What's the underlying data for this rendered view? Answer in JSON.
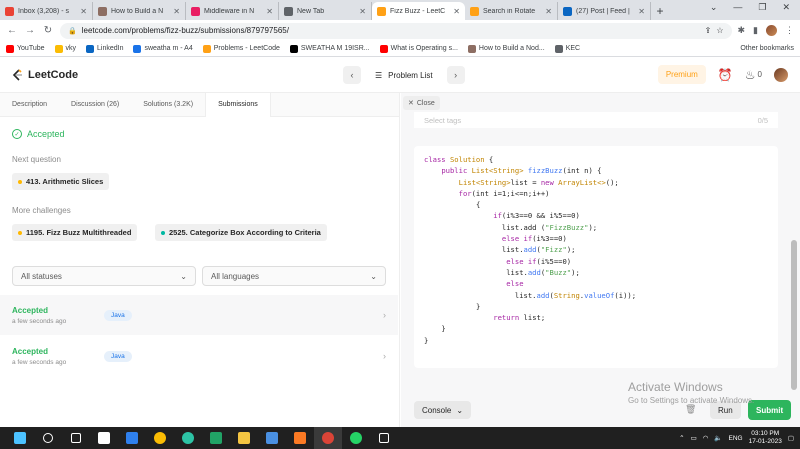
{
  "browser": {
    "tabs": [
      {
        "title": "Inbox (3,208) - s",
        "color": "#ea4335",
        "active": false
      },
      {
        "title": "How to Build a N",
        "color": "#8d6e63",
        "active": false
      },
      {
        "title": "Middleware in N",
        "color": "#e91e63",
        "active": false
      },
      {
        "title": "New Tab",
        "color": "#5f6368",
        "active": false
      },
      {
        "title": "Fizz Buzz - LeetC",
        "color": "#ffa116",
        "active": true
      },
      {
        "title": "Search in Rotate",
        "color": "#ffa116",
        "active": false
      },
      {
        "title": "(27) Post | Feed |",
        "color": "#0a66c2",
        "active": false
      }
    ],
    "new_tab": "+",
    "url": "leetcode.com/problems/fizz-buzz/submissions/879797565/",
    "bookmarks": [
      {
        "label": "YouTube",
        "color": "#ff0000"
      },
      {
        "label": "vky",
        "color": "#fbbc04"
      },
      {
        "label": "LinkedIn",
        "color": "#0a66c2"
      },
      {
        "label": "sweatha m - A4",
        "color": "#1a73e8"
      },
      {
        "label": "Problems - LeetCode",
        "color": "#ffa116"
      },
      {
        "label": "SWEATHA M 19ISR...",
        "color": "#000000"
      },
      {
        "label": "What is Operating s...",
        "color": "#ff0000"
      },
      {
        "label": "How to Build a Nod...",
        "color": "#8d6e63"
      },
      {
        "label": "KEC",
        "color": "#5f6368"
      }
    ],
    "other_bookmarks": "Other bookmarks"
  },
  "nav": {
    "logo": "LeetCode",
    "problem_list": "Problem List",
    "premium": "Premium",
    "streak_count": "0"
  },
  "left": {
    "tabs": [
      "Description",
      "Discussion (26)",
      "Solutions (3.2K)",
      "Submissions"
    ],
    "active_tab": 3,
    "status": "Accepted",
    "next_question_label": "Next question",
    "next_question": {
      "label": "413. Arithmetic Slices",
      "dot_color": "#ffb800"
    },
    "more_challenges_label": "More challenges",
    "challenges": [
      {
        "label": "1195. Fizz Buzz Multithreaded",
        "dot_color": "#ffb800"
      },
      {
        "label": "2525. Categorize Box According to Criteria",
        "dot_color": "#00b8a3"
      }
    ],
    "filters": {
      "statuses": "All statuses",
      "languages": "All languages"
    },
    "submissions": [
      {
        "status": "Accepted",
        "time": "a few seconds ago",
        "lang": "Java"
      },
      {
        "status": "Accepted",
        "time": "a few seconds ago",
        "lang": "Java"
      }
    ]
  },
  "right": {
    "close": "Close",
    "tags_placeholder": "Select tags",
    "tags_count": "0/5",
    "code_lines": [
      {
        "indent": 0,
        "tokens": [
          [
            "kw",
            "class "
          ],
          [
            "ty",
            "Solution "
          ],
          [
            "",
            "{"
          ]
        ]
      },
      {
        "indent": 4,
        "tokens": [
          [
            "kw",
            "public "
          ],
          [
            "ty",
            "List<String> "
          ],
          [
            "fn",
            "fizzBuzz"
          ],
          [
            "",
            "(int n) {"
          ]
        ]
      },
      {
        "indent": 8,
        "tokens": [
          [
            "ty",
            "List<String>"
          ],
          [
            "",
            "list = "
          ],
          [
            "kw",
            "new "
          ],
          [
            "ty",
            "ArrayList<>"
          ],
          [
            "",
            "();"
          ]
        ]
      },
      {
        "indent": 8,
        "tokens": [
          [
            "kw",
            "for"
          ],
          [
            "",
            "(int i=1;i<=n;i++)"
          ]
        ]
      },
      {
        "indent": 12,
        "tokens": [
          [
            "",
            "{"
          ]
        ]
      },
      {
        "indent": 16,
        "tokens": [
          [
            "kw",
            "if"
          ],
          [
            "",
            "(i%3==0 && i%5==0)"
          ]
        ]
      },
      {
        "indent": 18,
        "tokens": [
          [
            "",
            "list.add ("
          ],
          [
            "st2",
            "\"FizzBuzz\""
          ],
          [
            "",
            ");"
          ]
        ]
      },
      {
        "indent": 18,
        "tokens": [
          [
            "kw",
            "else if"
          ],
          [
            "",
            "(i%3==0)"
          ]
        ]
      },
      {
        "indent": 18,
        "tokens": [
          [
            "",
            "list."
          ],
          [
            "fn",
            "add"
          ],
          [
            "",
            "("
          ],
          [
            "st2",
            "\"Fizz\""
          ],
          [
            "",
            ");"
          ]
        ]
      },
      {
        "indent": 19,
        "tokens": [
          [
            "kw",
            "else if"
          ],
          [
            "",
            "(i%5==0)"
          ]
        ]
      },
      {
        "indent": 19,
        "tokens": [
          [
            "",
            "list."
          ],
          [
            "fn",
            "add"
          ],
          [
            "",
            "("
          ],
          [
            "st2",
            "\"Buzz\""
          ],
          [
            "",
            ");"
          ]
        ]
      },
      {
        "indent": 19,
        "tokens": [
          [
            "kw",
            "else"
          ]
        ]
      },
      {
        "indent": 21,
        "tokens": [
          [
            "",
            "list."
          ],
          [
            "fn",
            "add"
          ],
          [
            "",
            "("
          ],
          [
            "ty",
            "String"
          ],
          [
            "",
            "."
          ],
          [
            "fn",
            "valueOf"
          ],
          [
            "",
            "(i));"
          ]
        ]
      },
      {
        "indent": 12,
        "tokens": [
          [
            "",
            "}"
          ]
        ]
      },
      {
        "indent": 16,
        "tokens": [
          [
            "kw",
            "return "
          ],
          [
            "",
            "list;"
          ]
        ]
      },
      {
        "indent": 0,
        "tokens": [
          [
            "",
            ""
          ]
        ]
      },
      {
        "indent": 4,
        "tokens": [
          [
            "",
            "}"
          ]
        ]
      },
      {
        "indent": 0,
        "tokens": [
          [
            "",
            "}"
          ]
        ]
      }
    ],
    "console": "Console",
    "run": "Run",
    "submit": "Submit",
    "watermark_title": "Activate Windows",
    "watermark_sub": "Go to Settings to activate Windows."
  },
  "taskbar": {
    "apps": [
      {
        "name": "windows-start-icon",
        "color": "#4cc2ff"
      },
      {
        "name": "search-icon",
        "color": "#ffffff"
      },
      {
        "name": "task-view-icon",
        "color": "#ffffff"
      },
      {
        "name": "camera-app-icon",
        "color": "#ffffff"
      },
      {
        "name": "vscode-icon",
        "color": "#2f80ed"
      },
      {
        "name": "chrome-icon",
        "color": "#fbbc04"
      },
      {
        "name": "edge-icon",
        "color": "#2dc3a5"
      },
      {
        "name": "excel-icon",
        "color": "#21a366"
      },
      {
        "name": "file-explorer-icon",
        "color": "#f4c542"
      },
      {
        "name": "control-panel-icon",
        "color": "#4a90e2"
      },
      {
        "name": "xampp-icon",
        "color": "#fb7a24"
      },
      {
        "name": "chrome-active-icon",
        "color": "#db4437"
      },
      {
        "name": "whatsapp-icon",
        "color": "#25d366"
      },
      {
        "name": "settings-icon",
        "color": "#ffffff"
      }
    ],
    "lang": "ENG",
    "time": "03:10 PM",
    "date": "17-01-2023"
  }
}
